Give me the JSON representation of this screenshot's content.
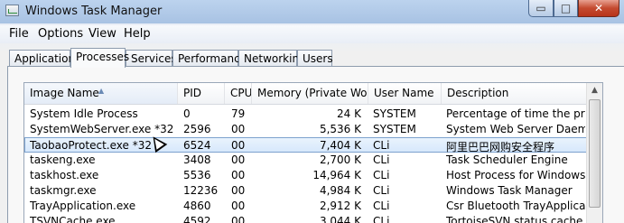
{
  "window": {
    "title": "Windows Task Manager"
  },
  "titlebar_buttons": {
    "minimize": "▭",
    "maximize": "□",
    "close": "✕"
  },
  "menu": [
    "File",
    "Options",
    "View",
    "Help"
  ],
  "tabs": [
    {
      "label": "Applications",
      "active": false
    },
    {
      "label": "Processes",
      "active": true
    },
    {
      "label": "Services",
      "active": false
    },
    {
      "label": "Performance",
      "active": false
    },
    {
      "label": "Networking",
      "active": false
    },
    {
      "label": "Users",
      "active": false
    }
  ],
  "table": {
    "columns": [
      "Image Name",
      "PID",
      "CPU",
      "Memory (Private Wor...",
      "User Name",
      "Description"
    ],
    "sorted_column": "Image Name",
    "rows": [
      {
        "name": "System Idle Process",
        "pid": "0",
        "cpu": "79",
        "mem": "24 K",
        "user": "SYSTEM",
        "desc": "Percentage of time the processo"
      },
      {
        "name": "SystemWebServer.exe *32",
        "pid": "2596",
        "cpu": "00",
        "mem": "5,536 K",
        "user": "SYSTEM",
        "desc": "System Web Server Daemon"
      },
      {
        "name": "TaobaoProtect.exe *32",
        "pid": "6524",
        "cpu": "00",
        "mem": "7,404 K",
        "user": "CLi",
        "desc": "阿里巴巴网购安全程序",
        "selected": true
      },
      {
        "name": "taskeng.exe",
        "pid": "3408",
        "cpu": "00",
        "mem": "2,700 K",
        "user": "CLi",
        "desc": "Task Scheduler Engine"
      },
      {
        "name": "taskhost.exe",
        "pid": "5536",
        "cpu": "00",
        "mem": "14,964 K",
        "user": "CLi",
        "desc": "Host Process for Windows Tasks"
      },
      {
        "name": "taskmgr.exe",
        "pid": "12236",
        "cpu": "00",
        "mem": "4,984 K",
        "user": "CLi",
        "desc": "Windows Task Manager"
      },
      {
        "name": "TrayApplication.exe",
        "pid": "4860",
        "cpu": "00",
        "mem": "2,912 K",
        "user": "CLi",
        "desc": "Csr Bluetooth TrayApplication"
      },
      {
        "name": "TSVNCache.exe",
        "pid": "4592",
        "cpu": "00",
        "mem": "3,044 K",
        "user": "CLi",
        "desc": "TortoiseSVN status cache"
      }
    ]
  }
}
